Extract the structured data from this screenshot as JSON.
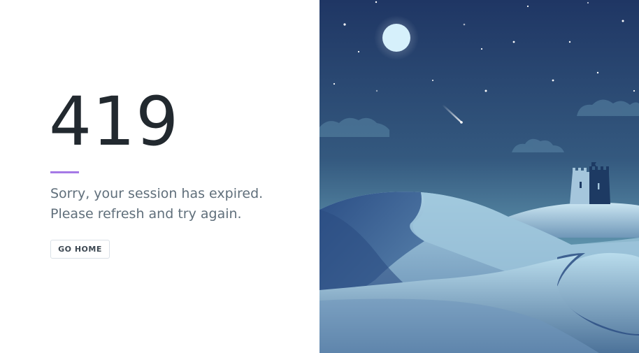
{
  "error": {
    "code": "419",
    "message_line1": "Sorry, your session has expired.",
    "message_line2": "Please refresh and try again."
  },
  "actions": {
    "home_label": "GO HOME"
  },
  "colors": {
    "code_text": "#22292f",
    "message_text": "#606f7b",
    "divider_accent": "#9561e2",
    "button_border": "#dae1e7",
    "sky_top": "#1f3664",
    "sky_bottom": "#5e93ac",
    "moon": "#d6f0fb"
  },
  "illustration": {
    "icon": "night-desert-castle-illustration"
  }
}
